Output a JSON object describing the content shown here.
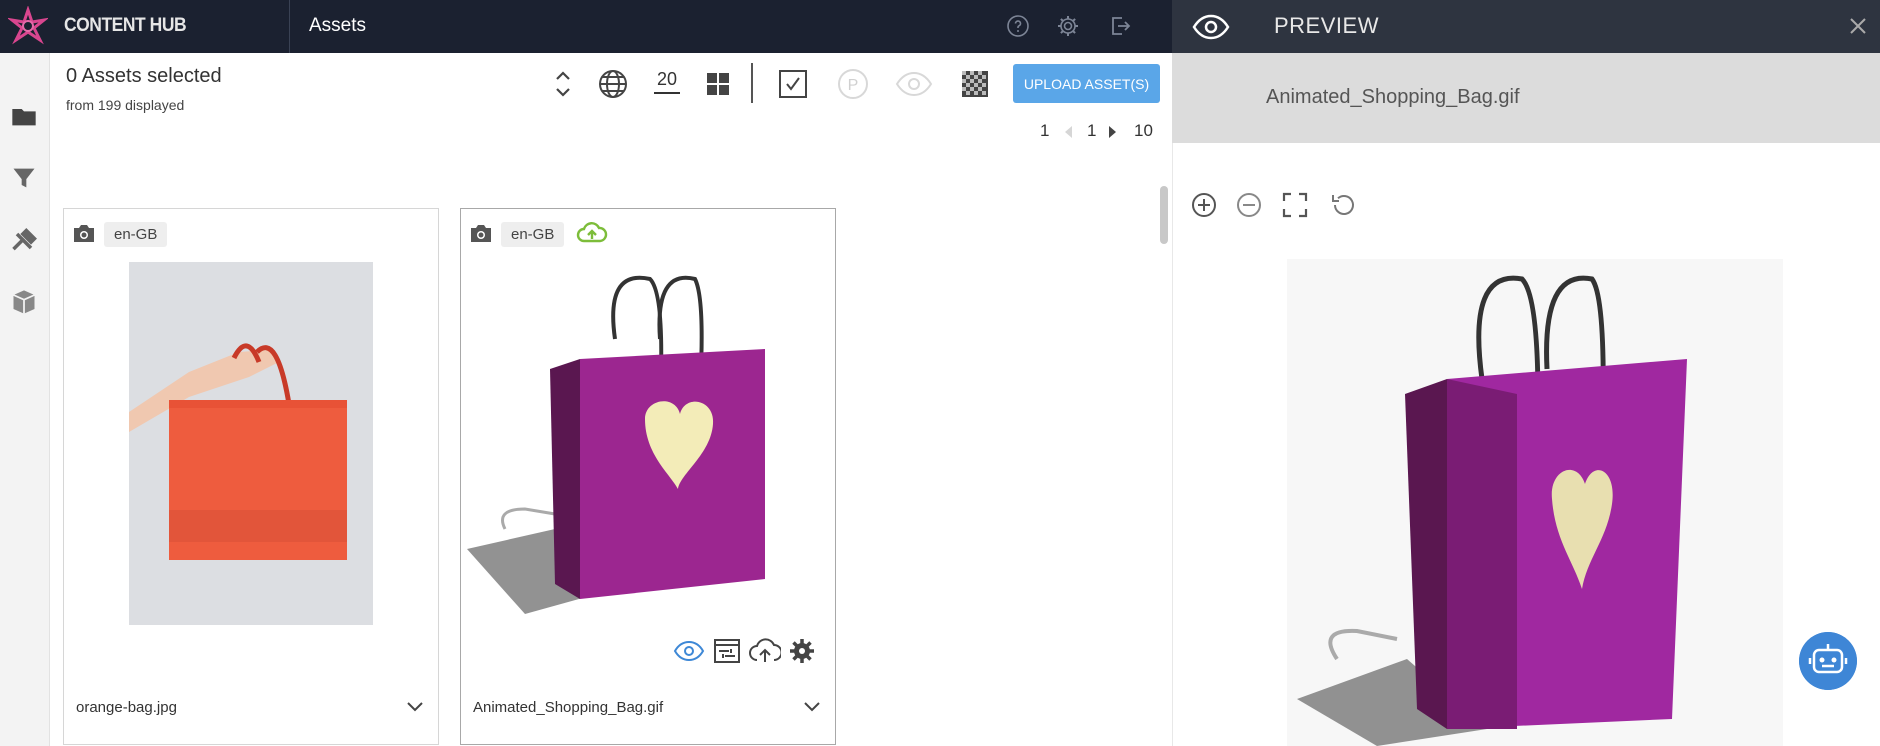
{
  "app": {
    "brand": "CONTENT HUB",
    "section": "Assets"
  },
  "selection": {
    "title": "0 Assets selected",
    "subtitle": "from 199 displayed"
  },
  "toolbar": {
    "page_size": "20",
    "upload_label": "UPLOAD ASSET(S)"
  },
  "pager": {
    "first": "1",
    "current": "1",
    "last": "10"
  },
  "assets": [
    {
      "locale": "en-GB",
      "filename": "orange-bag.jpg"
    },
    {
      "locale": "en-GB",
      "filename": "Animated_Shopping_Bag.gif"
    }
  ],
  "preview": {
    "title": "PREVIEW",
    "filename": "Animated_Shopping_Bag.gif"
  },
  "colors": {
    "accent": "#5aa6e8",
    "topbar": "#1b2130",
    "preview_header": "#2e3440",
    "pager_red": "#c8334a",
    "cloud_green": "#7dbd3a"
  }
}
